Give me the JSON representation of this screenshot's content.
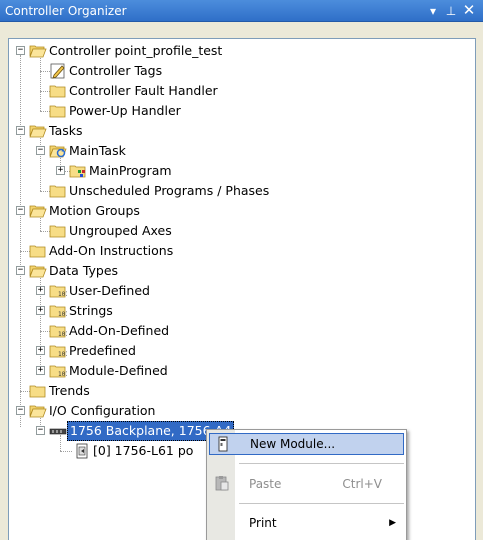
{
  "window": {
    "title": "Controller Organizer",
    "pin_glyph": "▾ ↓",
    "close_glyph": "✕"
  },
  "tree": {
    "controller": "Controller point_profile_test",
    "controller_tags": "Controller Tags",
    "fault_handler": "Controller Fault Handler",
    "powerup_handler": "Power-Up Handler",
    "tasks": "Tasks",
    "main_task": "MainTask",
    "main_program": "MainProgram",
    "unscheduled": "Unscheduled Programs / Phases",
    "motion_groups": "Motion Groups",
    "ungrouped_axes": "Ungrouped Axes",
    "addon_instructions": "Add-On Instructions",
    "data_types": "Data Types",
    "user_defined": "User-Defined",
    "strings": "Strings",
    "addon_defined": "Add-On-Defined",
    "predefined": "Predefined",
    "module_defined": "Module-Defined",
    "trends": "Trends",
    "io_config": "I/O Configuration",
    "backplane": "1756 Backplane, 1756-A4",
    "slot0": "[0] 1756-L61 po"
  },
  "context_menu": {
    "new_module": "New Module...",
    "paste": "Paste",
    "paste_shortcut": "Ctrl+V",
    "print": "Print"
  }
}
